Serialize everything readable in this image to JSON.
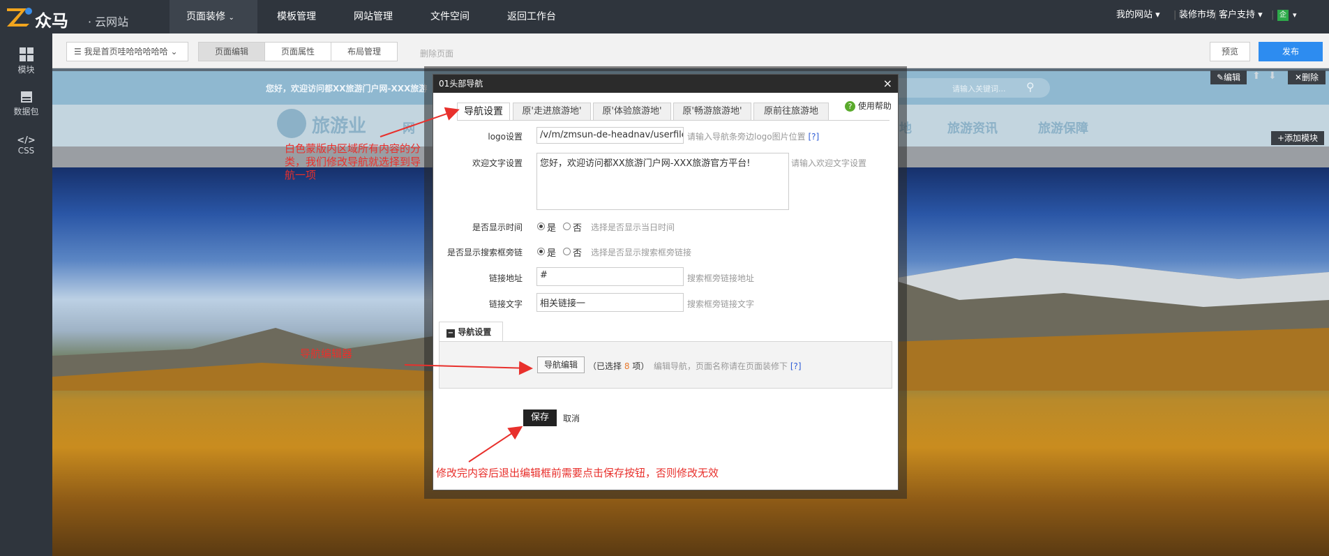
{
  "app": {
    "brand": "众马",
    "brand_sub": "· 云网站",
    "nav": [
      "页面装修",
      "模板管理",
      "网站管理",
      "文件空间",
      "返回工作台"
    ],
    "right_nav": [
      "我的网站",
      "装修市场",
      "客户支持",
      "企"
    ]
  },
  "sidebar": {
    "items": [
      {
        "label": "模块",
        "icon": "grid-icon"
      },
      {
        "label": "数据包",
        "icon": "database-icon"
      },
      {
        "label": "CSS",
        "icon": "code-icon"
      }
    ]
  },
  "toolbar": {
    "page_select": "我是首页哇哈哈哈哈哈",
    "tabs": [
      "页面编辑",
      "页面属性",
      "布局管理"
    ],
    "delete_page": "删除页面",
    "preview": "预览",
    "publish": "发布"
  },
  "canvas": {
    "welcome_text": "您好，欢迎访问都XX旅游门户网-XXX旅游",
    "search_placeholder": "请输入关键词...",
    "edit_label": "编辑",
    "delete_label": "删除",
    "add_module": "添加模块",
    "site_logo": "旅游业",
    "nav_partial": "网",
    "nav_links": [
      "地",
      "旅游资讯",
      "旅游保障"
    ]
  },
  "dialog": {
    "title": "01头部导航",
    "close": "×",
    "tabs": [
      "导航设置",
      "原'走进旅游地'",
      "原'体验旅游地'",
      "原'畅游旅游地'",
      "原前往旅游地"
    ],
    "help": "使用帮助",
    "logo_label": "logo设置",
    "logo_value": "/v/m/zmsun-de-headnav/userfiles/ir",
    "logo_hint": "请输入导航条旁边logo图片位置",
    "logo_hint_link": "[?]",
    "welcome_label": "欢迎文字设置",
    "welcome_value": "您好，欢迎访问都XX旅游门户网-XXX旅游官方平台!",
    "welcome_hint": "请输入欢迎文字设置",
    "showtime_label": "是否显示时间",
    "showtime_hint": "选择是否显示当日时间",
    "showsearch_label": "是否显示搜索框旁链",
    "showsearch_hint": "选择是否显示搜索框旁链接",
    "yes": "是",
    "no": "否",
    "link_addr_label": "链接地址",
    "link_addr_value": "#",
    "link_addr_hint": "搜索框旁链接地址",
    "link_text_label": "链接文字",
    "link_text_value": "相关链接一",
    "link_text_hint": "搜索框旁链接文字",
    "nav_section_title": "导航设置",
    "nav_edit_button": "导航编辑",
    "selected_prefix": "（已选择",
    "selected_count": "8",
    "selected_suffix": "项）",
    "nav_edit_hint": "编辑导航，页面名称请在页面装修下",
    "nav_edit_hint_link": "[?]",
    "save": "保存",
    "cancel": "取消"
  },
  "annotations": {
    "a1": "白色蒙版内区域所有内容的分类，我们修改导航就选择到导航一项",
    "a2": "导航编辑器",
    "a3": "修改完内容后退出编辑框前需要点击保存按钮，否则修改无效"
  },
  "colors": {
    "topbar": "#2f353d",
    "publish": "#2d8cf0",
    "annotation": "#e8302c",
    "selected_count": "#e8792c"
  }
}
